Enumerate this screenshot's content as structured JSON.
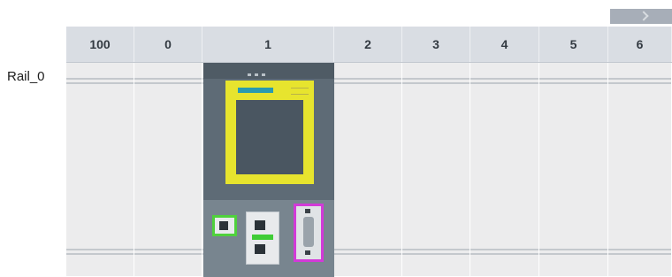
{
  "rail": {
    "label": "Rail_0"
  },
  "columns": [
    "100",
    "0",
    "1",
    "2",
    "3",
    "4",
    "5",
    "6"
  ],
  "module": {
    "slot": "1",
    "colors": {
      "body": "#5e6b76",
      "display_frame": "#e7e42e",
      "port_highlight_green": "#4fd13c",
      "port_highlight_magenta": "#d23ad8"
    }
  },
  "icons": [
    "corner-tab-icon",
    "profinet-port-icon",
    "dual-port-icon",
    "sub-d-port-icon"
  ]
}
